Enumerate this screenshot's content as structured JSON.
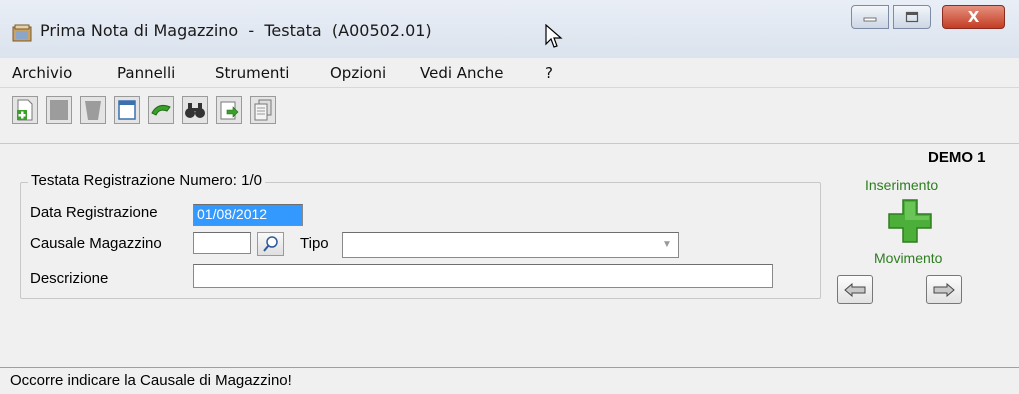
{
  "window": {
    "title": "Prima Nota di Magazzino  -  Testata  (A00502.01)",
    "controls": {
      "minimize_icon": "minimize-icon",
      "maximize_icon": "maximize-icon",
      "close_label": "X"
    }
  },
  "menu": {
    "items": [
      "Archivio",
      "Pannelli",
      "Strumenti",
      "Opzioni",
      "Vedi Anche",
      "?"
    ]
  },
  "toolbar": {
    "buttons": [
      "new-icon",
      "save-icon",
      "delete-icon",
      "window-icon",
      "undo-icon",
      "search-icon",
      "export-icon",
      "print-icon"
    ]
  },
  "company": "DEMO 1",
  "form": {
    "group_title": "Testata Registrazione Numero: 1/0",
    "data_registrazione": {
      "label": "Data Registrazione",
      "value": "01/08/2012"
    },
    "causale_magazzino": {
      "label": "Causale Magazzino",
      "value": ""
    },
    "tipo": {
      "label": "Tipo",
      "value": ""
    },
    "descrizione": {
      "label": "Descrizione",
      "value": ""
    }
  },
  "side": {
    "inserimento_label": "Inserimento",
    "movimento_label": "Movimento"
  },
  "status": {
    "message": "Occorre indicare la Causale di Magazzino!"
  },
  "colors": {
    "accent_green": "#2e7d20",
    "selection_blue": "#3399ff",
    "close_red": "#c43d24"
  }
}
